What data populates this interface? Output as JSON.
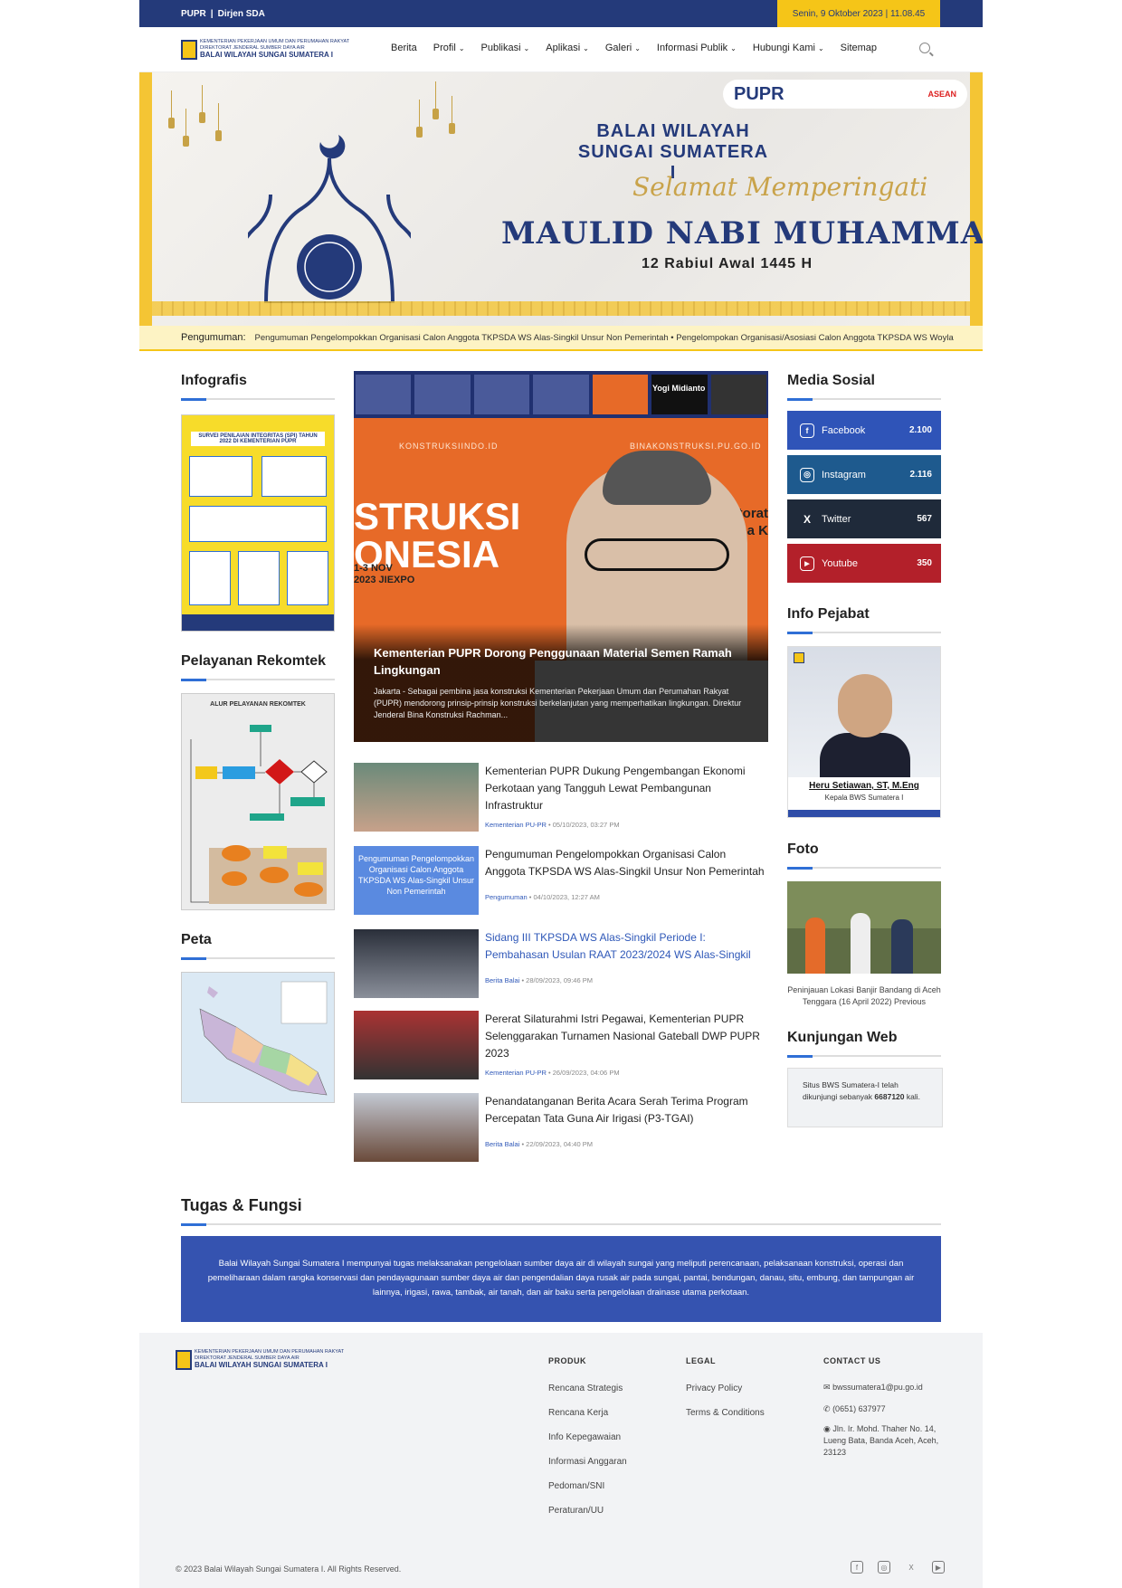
{
  "topbar": {
    "left_a": "PUPR",
    "sep": "|",
    "left_b": "Dirjen SDA",
    "datetime": "Senin, 9 Oktober 2023 | 11.08.45"
  },
  "logo": {
    "line1": "KEMENTERIAN PEKERJAAN UMUM DAN PERUMAHAN RAKYAT",
    "line2": "DIREKTORAT JENDERAL SUMBER DAYA AIR",
    "line3": "BALAI WILAYAH SUNGAI SUMATERA I"
  },
  "nav": {
    "items": [
      "Berita",
      "Profil",
      "Publikasi",
      "Aplikasi",
      "Galeri",
      "Informasi Publik",
      "Hubungi Kami",
      "Sitemap"
    ]
  },
  "banner": {
    "logo_text": "PUPR",
    "logo_sub": "ASEAN",
    "title": "BALAI WILAYAH SUNGAI SUMATERA I",
    "script": "Selamat Memperingati",
    "big": "MAULID NABI MUHAMMAD SAW",
    "sub": "12 Rabiul Awal 1445 H"
  },
  "announcement": {
    "label": "Pengumuman:",
    "text": "Pengumuman Pengelompokkan Organisasi Calon Anggota TKPSDA WS Alas-Singkil Unsur Non Pemerintah • Pengelompokan Organisasi/Asosiasi Calon Anggota TKPSDA WS Woyla"
  },
  "left": {
    "infografis_title": "Infografis",
    "infog_head": "SURVEI PENILAIAN INTEGRITAS (SPI) TAHUN 2022 DI KEMENTERIAN PUPR",
    "rekomtek_title": "Pelayanan Rekomtek",
    "rekomtek_head": "ALUR PELAYANAN REKOMTEK",
    "peta_title": "Peta"
  },
  "hero": {
    "tag_left": "KONSTRUKSIINDO.ID",
    "tag_right": "BINAKONSTRUKSI.PU.GO.ID",
    "bg_text": "STRUKSI ONESIA",
    "sticker": "1-3 NOV 2023 JIEXPO",
    "right_text": "irektorat Bina K",
    "speaker": "Yogi Midianto",
    "title": "Kementerian PUPR Dorong Penggunaan Material Semen Ramah Lingkungan",
    "desc": "Jakarta - Sebagai pembina jasa konstruksi Kementerian Pekerjaan Umum dan Perumahan Rakyat (PUPR) mendorong prinsip-prinsip konstruksi berkelanjutan yang memperhatikan lingkungan. Direktur Jenderal Bina Konstruksi Rachman..."
  },
  "news": [
    {
      "title": "Kementerian PUPR Dukung Pengembangan Ekonomi Perkotaan yang Tangguh Lewat Pembangunan Infrastruktur",
      "source": "Kementerian PU-PR",
      "date": "• 05/10/2023, 03:27 PM"
    },
    {
      "title": "Pengumuman Pengelompokkan Organisasi Calon Anggota TKPSDA WS Alas-Singkil Unsur Non Pemerintah",
      "source": "Pengumuman",
      "date": "• 04/10/2023, 12:27 AM",
      "thumb_text": "Pengumuman Pengelompokkan Organisasi Calon Anggota TKPSDA WS Alas-Singkil Unsur Non Pemerintah"
    },
    {
      "title": "Sidang III TKPSDA WS Alas-Singkil Periode I: Pembahasan Usulan RAAT 2023/2024 WS Alas-Singkil",
      "source": "Berita Balai",
      "date": "• 28/09/2023, 09:46 PM"
    },
    {
      "title": "Pererat Silaturahmi Istri Pegawai, Kementerian PUPR Selenggarakan Turnamen Nasional Gateball DWP PUPR 2023",
      "source": "Kementerian PU-PR",
      "date": "• 26/09/2023, 04:06 PM"
    },
    {
      "title": "Penandatanganan Berita Acara Serah Terima Program Percepatan Tata Guna Air Irigasi (P3-TGAI)",
      "source": "Berita Balai",
      "date": "• 22/09/2023, 04:40 PM"
    }
  ],
  "right": {
    "media_title": "Media Sosial",
    "social": [
      {
        "name": "Facebook",
        "count": "2.100",
        "color": "#2f54b8",
        "icon": "f"
      },
      {
        "name": "Instagram",
        "count": "2.116",
        "color": "#1e5a8e",
        "icon": "◎"
      },
      {
        "name": "Twitter",
        "count": "567",
        "color": "#1f2a3a",
        "icon": "X"
      },
      {
        "name": "Youtube",
        "count": "350",
        "color": "#b3202a",
        "icon": "▶"
      }
    ],
    "pejabat_title": "Info Pejabat",
    "pejabat_name": "Heru Setiawan, ST, M.Eng",
    "pejabat_role": "Kepala BWS Sumatera I",
    "foto_title": "Foto",
    "foto_caption": "Peninjauan Lokasi Banjir Bandang di Aceh Tenggara (16 April 2022) Previous",
    "kunjungan_title": "Kunjungan Web",
    "visits_pre": "Situs BWS Sumatera-I telah dikunjungi sebanyak",
    "visits_count": "6687120",
    "visits_post": "kali."
  },
  "tugas": {
    "title": "Tugas & Fungsi",
    "text": "Balai Wilayah Sungai Sumatera I mempunyai tugas melaksanakan pengelolaan sumber daya air di wilayah sungai yang meliputi perencanaan, pelaksanaan konstruksi, operasi dan pemeliharaan dalam rangka konservasi dan pendayagunaan sumber daya air dan pengendalian daya rusak air pada sungai, pantai, bendungan, danau, situ, embung, dan tampungan air lainnya, irigasi, rawa, tambak, air tanah, dan air baku serta pengelolaan drainase utama perkotaan."
  },
  "footer": {
    "produk_h": "PRODUK",
    "produk": [
      "Rencana Strategis",
      "Rencana Kerja",
      "Info Kepegawaian",
      "Informasi Anggaran",
      "Pedoman/SNI",
      "Peraturan/UU"
    ],
    "legal_h": "LEGAL",
    "legal": [
      "Privacy Policy",
      "Terms & Conditions"
    ],
    "contact_h": "CONTACT US",
    "email": "bwssumatera1@pu.go.id",
    "phone": "(0651) 637977",
    "address": "Jln. Ir. Mohd. Thaher No. 14, Lueng Bata, Banda Aceh, Aceh, 23123",
    "copyright": "© 2023 Balai Wilayah Sungai Sumatera I. All Rights Reserved."
  }
}
